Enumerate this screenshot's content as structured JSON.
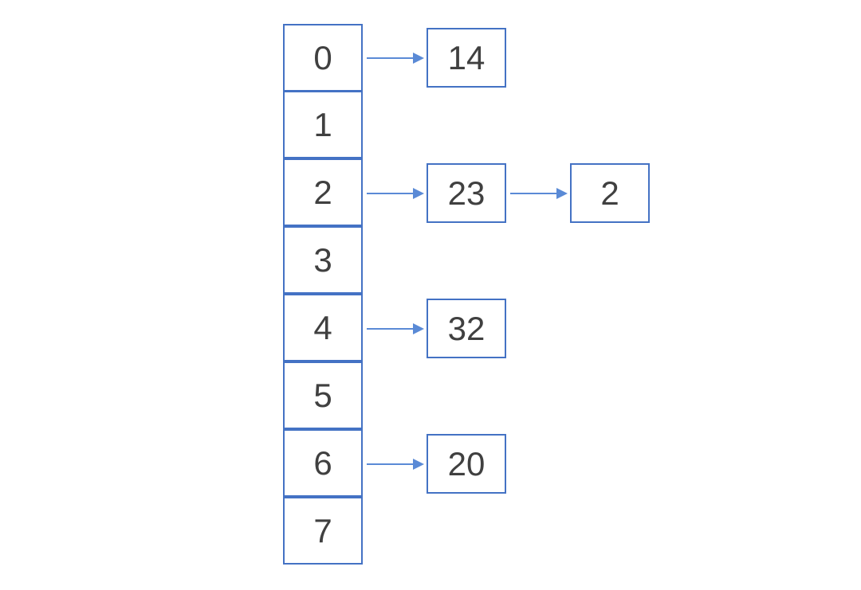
{
  "diagram": {
    "rows": [
      {
        "index": "0",
        "chain": [
          "14"
        ]
      },
      {
        "index": "1",
        "chain": []
      },
      {
        "index": "2",
        "chain": [
          "23",
          "2"
        ]
      },
      {
        "index": "3",
        "chain": []
      },
      {
        "index": "4",
        "chain": [
          "32"
        ]
      },
      {
        "index": "5",
        "chain": []
      },
      {
        "index": "6",
        "chain": [
          "20"
        ]
      },
      {
        "index": "7",
        "chain": []
      }
    ]
  },
  "colors": {
    "border": "#4472C4",
    "arrow": "#5A8AD6",
    "text": "#404040"
  }
}
